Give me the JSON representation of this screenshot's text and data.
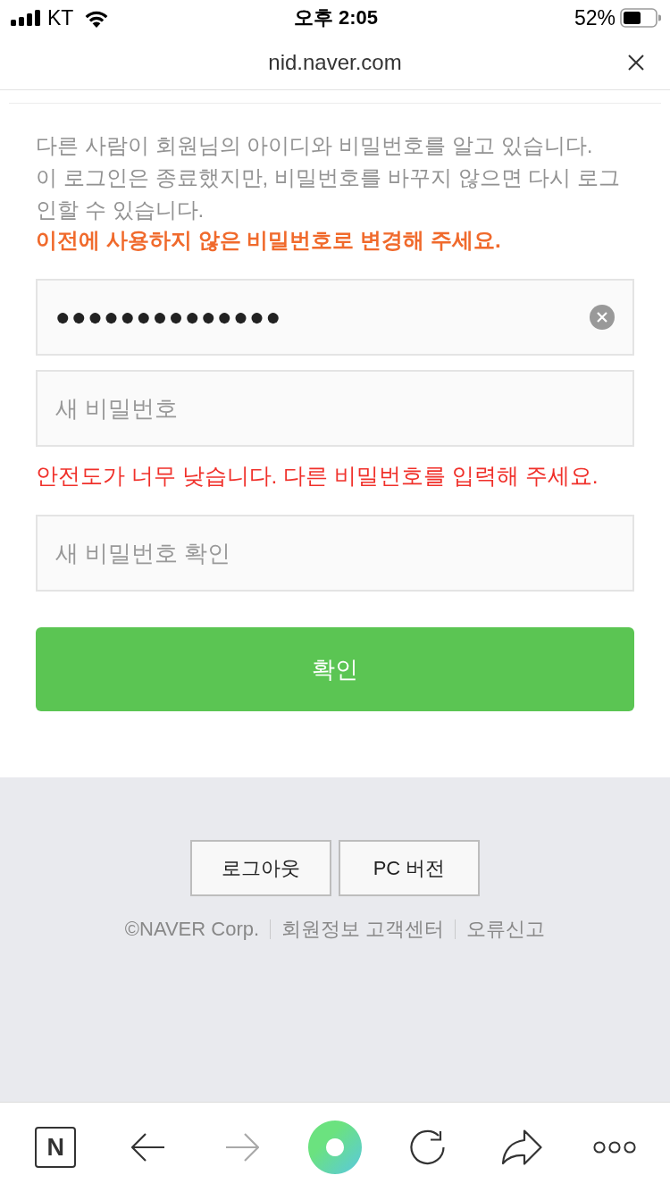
{
  "status_bar": {
    "carrier": "KT",
    "time": "오후 2:05",
    "battery": "52%"
  },
  "url_bar": {
    "url": "nid.naver.com"
  },
  "notice": {
    "lines": [
      "다른 사람이 회원님의 아이디와 비밀번호를 알고 있습니다.",
      "이 로그인은 종료했지만, 비밀번호를 바꾸지 않으면 다시 로그인할 수 있습니다."
    ],
    "emphasis": "이전에 사용하지 않은 비밀번호로 변경해 주세요."
  },
  "fields": [
    {
      "value": "●●●●●●●●●●●●●●"
    },
    {
      "placeholder": "새 비밀번호",
      "error": "안전도가 너무 낮습니다. 다른 비밀번호를 입력해 주세요."
    },
    {
      "placeholder": "새 비밀번호 확인"
    }
  ],
  "submit_button": "확인",
  "footer": {
    "buttons": [
      "로그아웃",
      "PC 버전"
    ],
    "links": [
      "©NAVER Corp.",
      "회원정보 고객센터",
      "오류신고"
    ]
  },
  "toolbar": [
    {
      "kind": "home",
      "label": "N",
      "disabled": false
    },
    {
      "kind": "back",
      "disabled": false
    },
    {
      "kind": "forward",
      "disabled": true
    },
    {
      "kind": "circle",
      "disabled": false
    },
    {
      "kind": "refresh",
      "disabled": false
    },
    {
      "kind": "share",
      "disabled": false
    },
    {
      "kind": "more",
      "disabled": false
    }
  ]
}
